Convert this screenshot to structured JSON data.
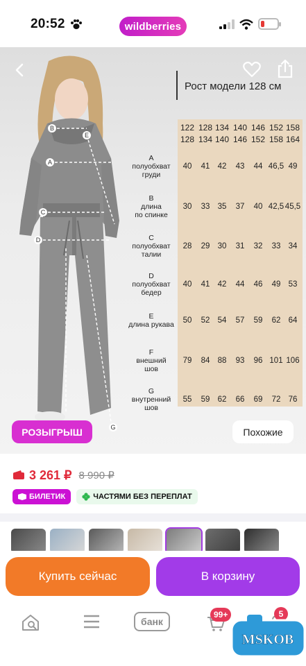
{
  "status_bar": {
    "time": "20:52"
  },
  "header": {
    "logo_text": "wildberries"
  },
  "product_image": {
    "model_height": "Рост модели 128 см",
    "size_columns": [
      {
        "top": "122",
        "bottom": "128"
      },
      {
        "top": "128",
        "bottom": "134"
      },
      {
        "top": "134",
        "bottom": "140"
      },
      {
        "top": "140",
        "bottom": "146"
      },
      {
        "top": "146",
        "bottom": "152"
      },
      {
        "top": "152",
        "bottom": "158"
      },
      {
        "top": "158",
        "bottom": "164"
      }
    ],
    "rows": [
      {
        "label": "A\nполуобхват\nгруди",
        "values": [
          "40",
          "41",
          "42",
          "43",
          "44",
          "46,5",
          "49"
        ]
      },
      {
        "label": "B\nдлина\nпо спинке",
        "values": [
          "30",
          "33",
          "35",
          "37",
          "40",
          "42,5",
          "45,5"
        ]
      },
      {
        "label": "C\nполуобхват\nталии",
        "values": [
          "28",
          "29",
          "30",
          "31",
          "32",
          "33",
          "34"
        ]
      },
      {
        "label": "D\nполуобхват\nбедер",
        "values": [
          "40",
          "41",
          "42",
          "44",
          "46",
          "49",
          "53"
        ]
      },
      {
        "label": "E\nдлина рукава",
        "values": [
          "50",
          "52",
          "54",
          "57",
          "59",
          "62",
          "64"
        ]
      },
      {
        "label": "F\nвнешний\nшов",
        "values": [
          "79",
          "84",
          "88",
          "93",
          "96",
          "101",
          "106"
        ]
      },
      {
        "label": "G\nвнутренний\nшов",
        "values": [
          "55",
          "59",
          "62",
          "66",
          "69",
          "72",
          "76"
        ]
      }
    ],
    "diagram_markers": [
      "B",
      "E",
      "A",
      "C",
      "D",
      "G"
    ],
    "giveaway_label": "РОЗЫГРЫШ",
    "similar_label": "Похожие"
  },
  "price": {
    "current": "3 261 ₽",
    "old": "8 990 ₽",
    "badges": [
      "БИЛЕТИК",
      "ЧАСТЯМИ БЕЗ ПЕРЕПЛАТ"
    ]
  },
  "thumbnails": [
    "thumb-1",
    "thumb-2",
    "thumb-3",
    "thumb-4",
    "thumb-5",
    "thumb-6",
    "thumb-7",
    "thumb-8"
  ],
  "actions": {
    "buy_now": "Купить сейчас",
    "add_to_cart": "В корзину"
  },
  "tabbar": {
    "bank_label": "банк",
    "cart_count": "99+",
    "profile_count": "5"
  },
  "watermark": {
    "text": "MSKOB"
  },
  "colors": {
    "brand": "#cb11d4",
    "buy_now": "#f27a28",
    "cart": "#a23be8",
    "price": "#e02a3a",
    "size_column": "#ead8bf"
  }
}
